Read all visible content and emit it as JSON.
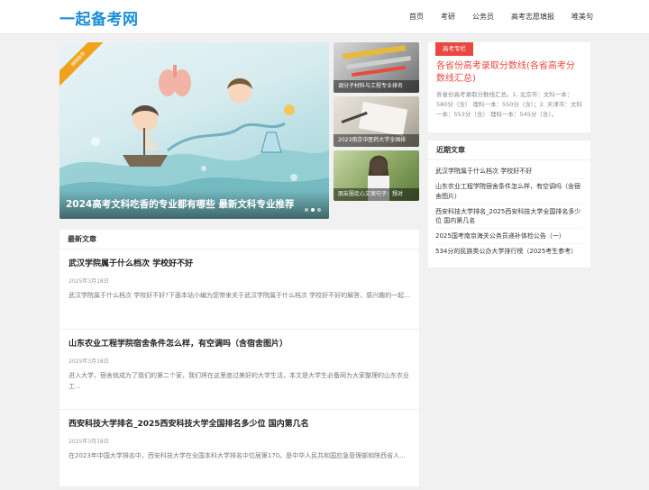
{
  "header": {
    "logo": "一起备考网",
    "nav": [
      "首页",
      "考研",
      "公务员",
      "高考志愿填报",
      "唯美句"
    ]
  },
  "slider": {
    "ribbon": "编辑推荐",
    "title": "2024高考文科吃香的专业都有哪些 最新文科专业推荐"
  },
  "thumbs": [
    {
      "caption": "调分子材料与工程专业排名"
    },
    {
      "caption": "2023南京中医药大学全国排"
    },
    {
      "caption": "朋友圈走心文案句子：想对"
    }
  ],
  "latest": {
    "heading": "最新文章",
    "articles": [
      {
        "title": "武汉学院属于什么档次 学校好不好",
        "date": "2025年3月18日",
        "desc": "武汉学院属于什么档次 学校好不好?下面本站小编为您带来关于武汉学院属于什么档次 学校好不好的解答，感兴趣的一起..."
      },
      {
        "title": "山东农业工程学院宿舍条件怎么样，有空调吗（含宿舍图片）",
        "date": "2025年3月18日",
        "desc": "进入大学，宿舍就成为了我们的第二个家，我们将在这里度过美好的大学生活，本文是大学生必备网为大家整理的山东农业工..."
      },
      {
        "title": "西安科技大学排名_2025西安科技大学全国排名多少位 国内第几名",
        "date": "2025年3月18日",
        "desc": "在2023年中国大学排名中，西安科技大学在全国本科大学排名中位居第170。是中华人民共和国应急管理部和陕西省人..."
      }
    ]
  },
  "featured": {
    "badge": "高考专栏",
    "title": "各省份高考录取分数线(各省高考分数线汇总)",
    "desc": "各省份高考录取分数线汇总。1. 北京市：文科一本：580分（含） 理科一本：550分（含）；2. 天津市：文科一本：553分（含） 理科一本：545分（含）。"
  },
  "recent": {
    "heading": "近期文章",
    "items": [
      "武汉学院属于什么档次 学校好不好",
      "山东农业工程学院宿舍条件怎么样，有空调吗（含宿舍图片）",
      "西安科技大学排名_2025西安科技大学全国排名多少位 国内第几名",
      "2025国考南京海关公务员递补体检公告（一）",
      "534分的民族类公办大学排行榜（2025考生参考）"
    ]
  }
}
